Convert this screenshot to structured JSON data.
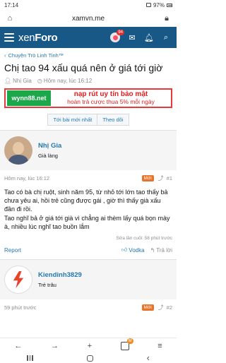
{
  "status": {
    "time": "17:14",
    "battery": "97%"
  },
  "browser": {
    "url": "xamvn.me"
  },
  "header": {
    "logo_main": "xen",
    "logo_sub": "Foro",
    "alert_count": "94"
  },
  "breadcrumb": {
    "label": "Chuyện Trò Linh Tinh™"
  },
  "thread": {
    "title": "Chị tao 94 xấu quá nên ở giá tới giờ",
    "author": "Nhị Gia",
    "time": "Hôm nay, lúc 16:12"
  },
  "ad": {
    "logo": "wynn88.net",
    "line1": "nạp rút uy tín bảo mật",
    "line2": "hoàn trả cược thua 5% mỗi ngày"
  },
  "thread_actions": {
    "latest": "Tới bài mới nhất",
    "follow": "Theo dõi"
  },
  "posts": [
    {
      "username": "Nhị Gia",
      "user_title": "Già làng",
      "time": "Hôm nay, lúc 16:12",
      "badge": "Mới",
      "number": "#1",
      "body": [
        "Tao có bà chị ruột, sinh năm 95, từ nhỏ tới lớn tao thấy bả chưa yêu ai, hồi trẻ cũng được gái , giờ thì thấy già xấu đần đi rồi.",
        "Tao nghĩ bả ở giá tới già vì chẳng ai thèm lấy quá bọn mày à, nhiều lúc nghĩ tao buồn lắm"
      ],
      "edited": "Sửa lần cuối: 58 phút trước",
      "report": "Report",
      "react": "Vodka",
      "reply": "Trả lời"
    },
    {
      "username": "Kiendinh3829",
      "user_title": "Trẻ trâu",
      "time": "59 phút trước",
      "badge": "Mới",
      "number": "#2"
    }
  ],
  "bottom": {
    "tab_badge": "M"
  }
}
